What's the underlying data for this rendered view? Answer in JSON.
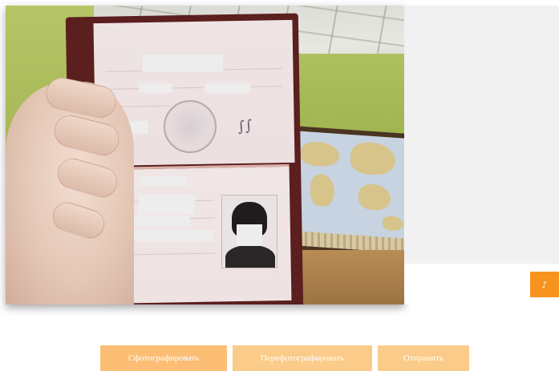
{
  "camera": {
    "icons": {
      "seal": "coat-of-arms-seal-icon"
    }
  },
  "side_panel": {
    "send_icon_glyph": "♪",
    "accent": "#f7931e"
  },
  "actions": {
    "take_photo_label": "Сфотографировать",
    "retake_photo_label": "Перефотографировать",
    "send_label": "Отправить",
    "button_color": "#fbc77f"
  }
}
